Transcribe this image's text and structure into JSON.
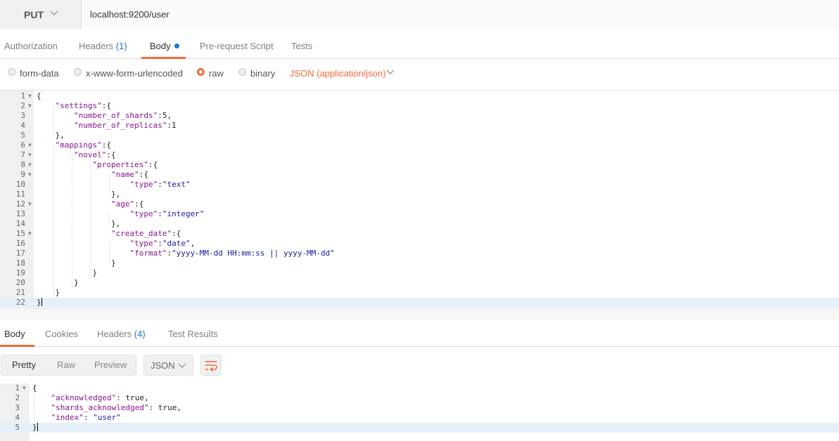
{
  "request": {
    "method": "PUT",
    "url": "localhost:9200/user"
  },
  "request_tabs": [
    {
      "label": "Authorization"
    },
    {
      "label": "Headers",
      "count": "(1)"
    },
    {
      "label": "Body"
    },
    {
      "label": "Pre-request Script"
    },
    {
      "label": "Tests"
    }
  ],
  "body_types": {
    "form_data": "form-data",
    "urlencoded": "x-www-form-urlencoded",
    "raw": "raw",
    "binary": "binary",
    "selected": "raw",
    "content_type": "JSON (application/json)"
  },
  "request_body": {
    "line_numbers": [
      "1",
      "2",
      "3",
      "4",
      "5",
      "6",
      "7",
      "8",
      "9",
      "10",
      "11",
      "12",
      "13",
      "14",
      "15",
      "16",
      "17",
      "18",
      "19",
      "20",
      "21",
      "22"
    ],
    "l1": "{",
    "l2k": "\"settings\"",
    "l2r": ":{",
    "l3k": "\"number_of_shards\"",
    "l3r": ":5,",
    "l4k": "\"number_of_replicas\"",
    "l4r": ":1",
    "l5": "},",
    "l6k": "\"mappings\"",
    "l6r": ":{",
    "l7k": "\"novel\"",
    "l7r": ":{",
    "l8k": "\"properties\"",
    "l8r": ":{",
    "l9k": "\"name\"",
    "l9r": ":{",
    "l10k": "\"type\"",
    "l10c": ":",
    "l10v": "\"text\"",
    "l11": "},",
    "l12k": "\"age\"",
    "l12r": ":{",
    "l13k": "\"type\"",
    "l13c": ":",
    "l13v": "\"integer\"",
    "l14": "},",
    "l15k": "\"create_date\"",
    "l15r": ":{",
    "l16k": "\"type\"",
    "l16c": ":",
    "l16v": "\"date\"",
    "l16e": ",",
    "l17k": "\"format\"",
    "l17c": ":",
    "l17v": "\"yyyy-MM-dd HH:mm:ss || yyyy-MM-dd\"",
    "l18": "}",
    "l19": "}",
    "l20": "}",
    "l21": "}",
    "l22": "}"
  },
  "response_tabs": [
    {
      "label": "Body"
    },
    {
      "label": "Cookies"
    },
    {
      "label": "Headers",
      "count": "(4)"
    },
    {
      "label": "Test Results"
    }
  ],
  "response_toolbar": {
    "pretty": "Pretty",
    "raw": "Raw",
    "preview": "Preview",
    "format": "JSON"
  },
  "response_body": {
    "line_numbers": [
      "1",
      "2",
      "3",
      "4",
      "5"
    ],
    "l1": "{",
    "l2k": "\"acknowledged\"",
    "l2r": ": true,",
    "l3k": "\"shards_acknowledged\"",
    "l3r": ": true,",
    "l4k": "\"index\"",
    "l4c": ": ",
    "l4v": "\"user\"",
    "l5": "}"
  },
  "colors": {
    "accent": "#f26b3a",
    "link_blue": "#2275c6",
    "json_key": "#881391",
    "json_string": "#1a1aa6"
  },
  "icons": {
    "method_dropdown": "chevron-down-icon",
    "content_type_dropdown": "chevron-down-icon",
    "format_dropdown": "chevron-down-icon",
    "wrap": "wrap-lines-icon"
  }
}
